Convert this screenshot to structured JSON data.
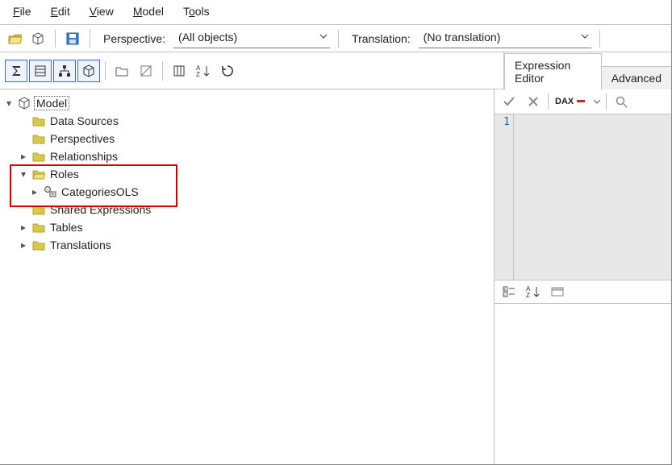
{
  "menu": {
    "file": "File",
    "edit": "Edit",
    "view": "View",
    "model": "Model",
    "tools": "Tools"
  },
  "toolbar": {
    "perspective_label": "Perspective:",
    "perspective_value": "(All objects)",
    "translation_label": "Translation:",
    "translation_value": "(No translation)"
  },
  "right": {
    "tab_editor": "Expression Editor",
    "tab_advanced": "Advanced",
    "dax_label": "DAX",
    "gutter_line": "1"
  },
  "tree": {
    "root": "Model",
    "data_sources": "Data Sources",
    "perspectives": "Perspectives",
    "relationships": "Relationships",
    "roles": "Roles",
    "roles_child": "CategoriesOLS",
    "shared_expr": "Shared Expressions",
    "tables": "Tables",
    "translations": "Translations"
  }
}
